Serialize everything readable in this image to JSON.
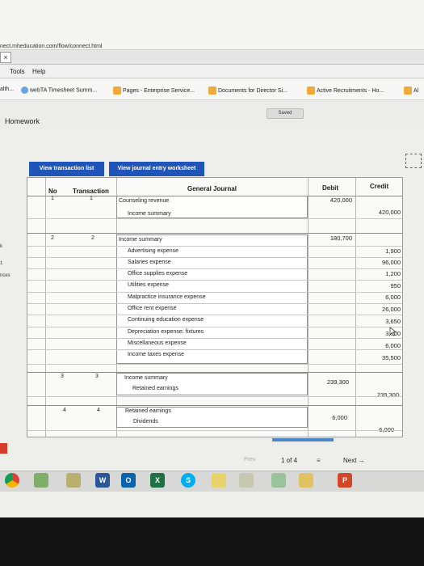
{
  "browser": {
    "url": "nect.mheducation.com/flow/connect.html",
    "tab_close": "×",
    "menu": [
      "Tools",
      "Help"
    ],
    "bookmarks": [
      "alth...",
      "webTA Timesheet Summ...",
      "Pages - Enterprise Service...",
      "Documents for Director Si...",
      "Active Recruitments - Ho...",
      "Al"
    ]
  },
  "app": {
    "title": "Homework",
    "saved_label": "Saved",
    "buttons": {
      "view_transaction_list": "View transaction list",
      "view_journal_entry_worksheet": "View journal entry worksheet"
    }
  },
  "journal": {
    "headers": {
      "no": "No",
      "transaction": "Transaction",
      "general_journal": "General Journal",
      "debit": "Debit",
      "credit": "Credit"
    },
    "entries": [
      {
        "no": "1",
        "transaction": "1",
        "lines": [
          {
            "account": "Counseling revenue",
            "debit": "420,000",
            "credit": ""
          },
          {
            "account": "Income summary",
            "debit": "",
            "credit": "420,000"
          }
        ]
      },
      {
        "no": "2",
        "transaction": "2",
        "lines": [
          {
            "account": "Income summary",
            "debit": "180,700",
            "credit": ""
          },
          {
            "account": "Advertising expense",
            "debit": "",
            "credit": "1,900"
          },
          {
            "account": "Salaries expense",
            "debit": "",
            "credit": "96,000"
          },
          {
            "account": "Office supplies expense",
            "debit": "",
            "credit": "1,200"
          },
          {
            "account": "Utilities expense",
            "debit": "",
            "credit": "950"
          },
          {
            "account": "Malpractice insurance expense",
            "debit": "",
            "credit": "6,000"
          },
          {
            "account": "Office rent expense",
            "debit": "",
            "credit": "26,000"
          },
          {
            "account": "Continuing education expense",
            "debit": "",
            "credit": "3,650"
          },
          {
            "account": "Depreciation expense: fixtures",
            "debit": "",
            "credit": "3,500"
          },
          {
            "account": "Miscellaneous expense",
            "debit": "",
            "credit": "6,000"
          },
          {
            "account": "Income taxes expense",
            "debit": "",
            "credit": "35,500"
          }
        ]
      },
      {
        "no": "3",
        "transaction": "3",
        "lines": [
          {
            "account": "Income summary",
            "debit": "239,300",
            "credit": ""
          },
          {
            "account": "Retained earnings",
            "debit": "",
            "credit": "239,300"
          }
        ]
      },
      {
        "no": "4",
        "transaction": "4",
        "lines": [
          {
            "account": "Retained earnings",
            "debit": "6,000",
            "credit": ""
          },
          {
            "account": "Dividends",
            "debit": "",
            "credit": "6,000"
          }
        ]
      }
    ]
  },
  "pager": {
    "prev": "Prev",
    "page_of": "1 of 4",
    "lines_icon": "≡",
    "next": "Next"
  },
  "left_cutoff": [
    "k",
    "1",
    "nces"
  ],
  "taskbar": {
    "icons": [
      "chrome-icon",
      "tools-icon",
      "paint-icon",
      "word-icon",
      "outlook-icon",
      "excel-icon",
      "skype-icon",
      "notes-icon",
      "folder-icon",
      "ie-icon",
      "powerpoint-icon"
    ],
    "word_letter": "W",
    "outlook_letter": "O",
    "excel_letter": "X",
    "skype_letter": "S",
    "ppt_letter": "P"
  }
}
